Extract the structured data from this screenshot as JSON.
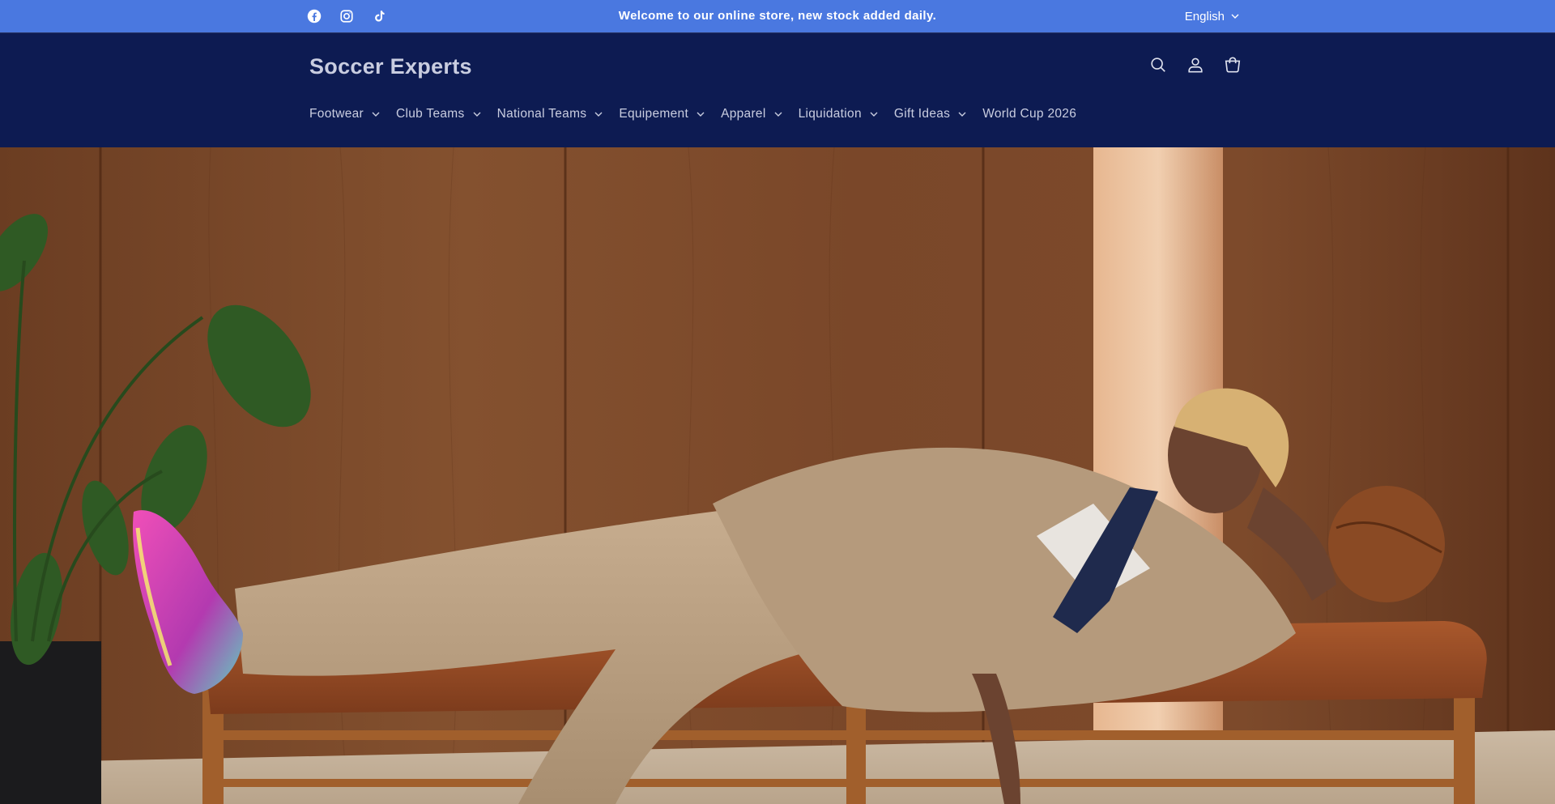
{
  "announcement": {
    "message": "Welcome to our online store, new stock added daily.",
    "socials": [
      "facebook-icon",
      "instagram-icon",
      "tiktok-icon"
    ],
    "language": "English"
  },
  "header": {
    "logo": "Soccer Experts",
    "icons": [
      "search-icon",
      "account-icon",
      "cart-icon"
    ]
  },
  "nav": {
    "items": [
      {
        "label": "Footwear",
        "has_dropdown": true
      },
      {
        "label": "Club Teams",
        "has_dropdown": true
      },
      {
        "label": "National Teams",
        "has_dropdown": true
      },
      {
        "label": "Equipement",
        "has_dropdown": true
      },
      {
        "label": "Apparel",
        "has_dropdown": true
      },
      {
        "label": "Liquidation",
        "has_dropdown": true
      },
      {
        "label": "Gift Ideas",
        "has_dropdown": true
      },
      {
        "label": "World Cup 2026",
        "has_dropdown": false
      }
    ]
  },
  "colors": {
    "announcement_bg": "#4a78e0",
    "header_bg": "#0d1b52",
    "nav_text": "#c9cde0"
  }
}
